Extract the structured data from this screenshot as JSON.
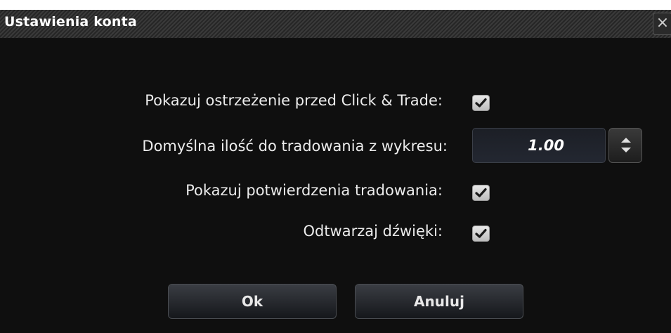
{
  "dialog": {
    "title": "Ustawienia konta",
    "close_glyph": "×"
  },
  "settings": {
    "click_trade_warning": {
      "label": "Pokazuj ostrzeżenie przed Click & Trade:",
      "checked": true
    },
    "default_quantity": {
      "label": "Domyślna ilość do tradowania z wykresu:",
      "value": "1.00"
    },
    "trade_confirmations": {
      "label": "Pokazuj potwierdzenia tradowania:",
      "checked": true
    },
    "play_sounds": {
      "label": "Odtwarzaj dźwięki:",
      "checked": true
    }
  },
  "buttons": {
    "ok": "Ok",
    "cancel": "Anuluj"
  },
  "icons": {
    "checkmark": "check-icon",
    "stepper": "stepper-icon",
    "close": "close-icon"
  }
}
